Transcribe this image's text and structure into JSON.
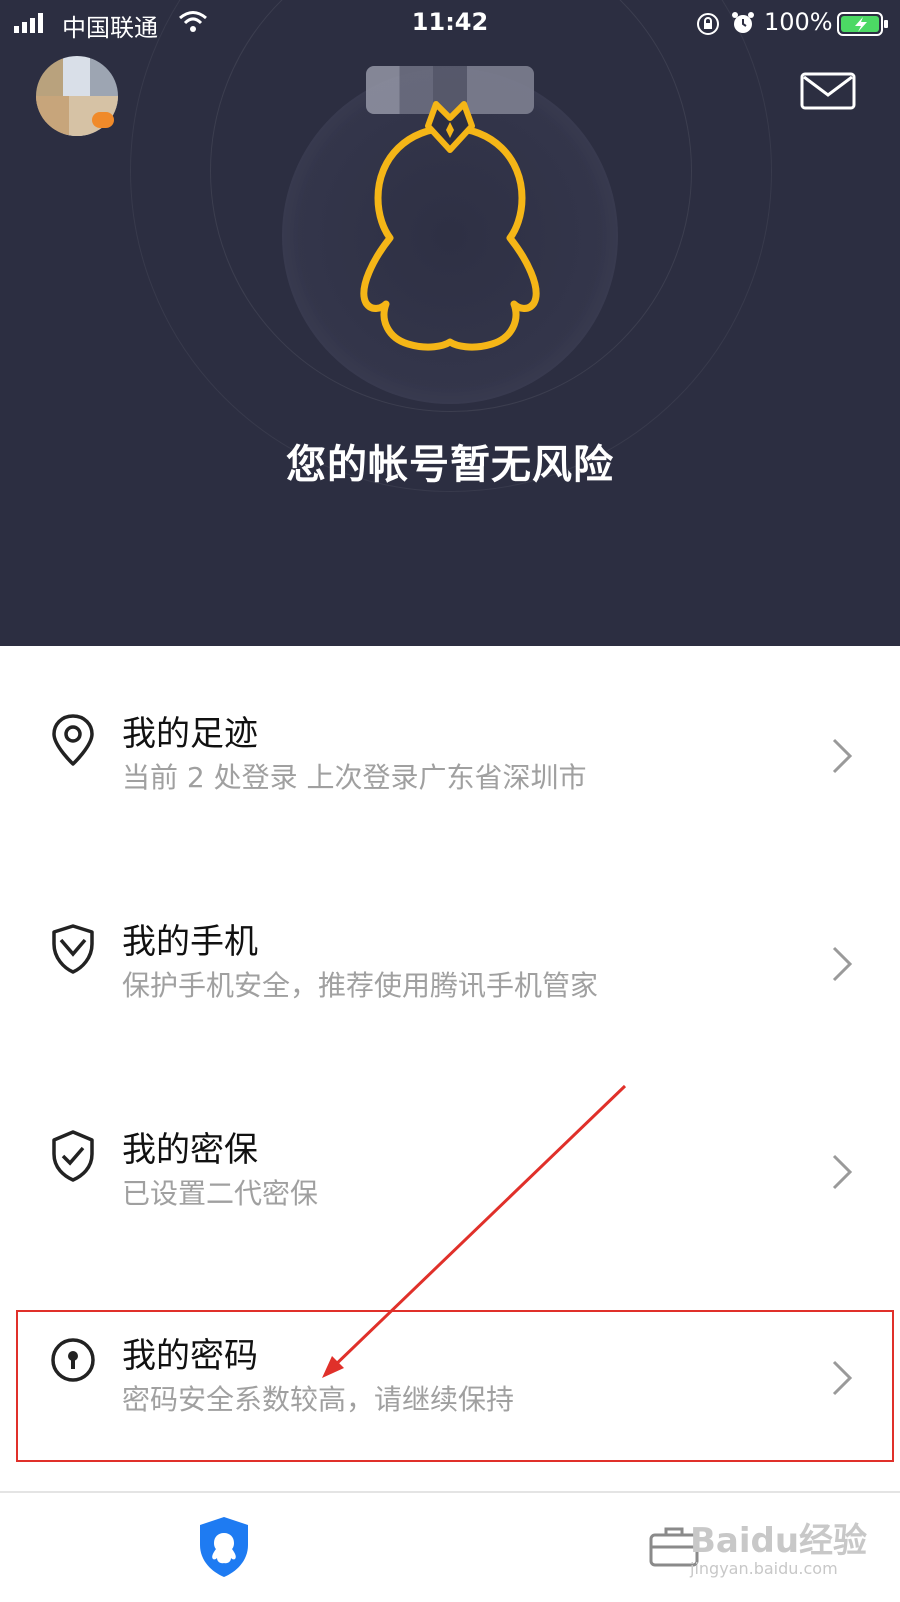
{
  "status_bar": {
    "carrier": "中国联通",
    "time": "11:42",
    "battery_percent": "100%"
  },
  "header": {
    "status_title": "您的帐号暂无风险",
    "icons": {
      "mail": "mail-icon",
      "mascot": "qq-penguin-icon"
    },
    "colors": {
      "background": "#2c2e41",
      "accent": "#f5b617"
    }
  },
  "menu": {
    "items": [
      {
        "icon": "location-pin-icon",
        "title": "我的足迹",
        "subtitle": "当前 2 处登录 上次登录广东省深圳市"
      },
      {
        "icon": "phone-guard-icon",
        "title": "我的手机",
        "subtitle": "保护手机安全，推荐使用腾讯手机管家"
      },
      {
        "icon": "shield-check-icon",
        "title": "我的密保",
        "subtitle": "已设置二代密保"
      },
      {
        "icon": "keyhole-icon",
        "title": "我的密码",
        "subtitle": "密码安全系数较高，请继续保持"
      }
    ]
  },
  "annotation": {
    "highlight_color": "#e0302a"
  },
  "tabbar": {
    "tabs": [
      "security-shield-icon",
      "toolbox-icon"
    ],
    "watermark": "Baidu经验",
    "watermark_url": "jingyan.baidu.com"
  }
}
